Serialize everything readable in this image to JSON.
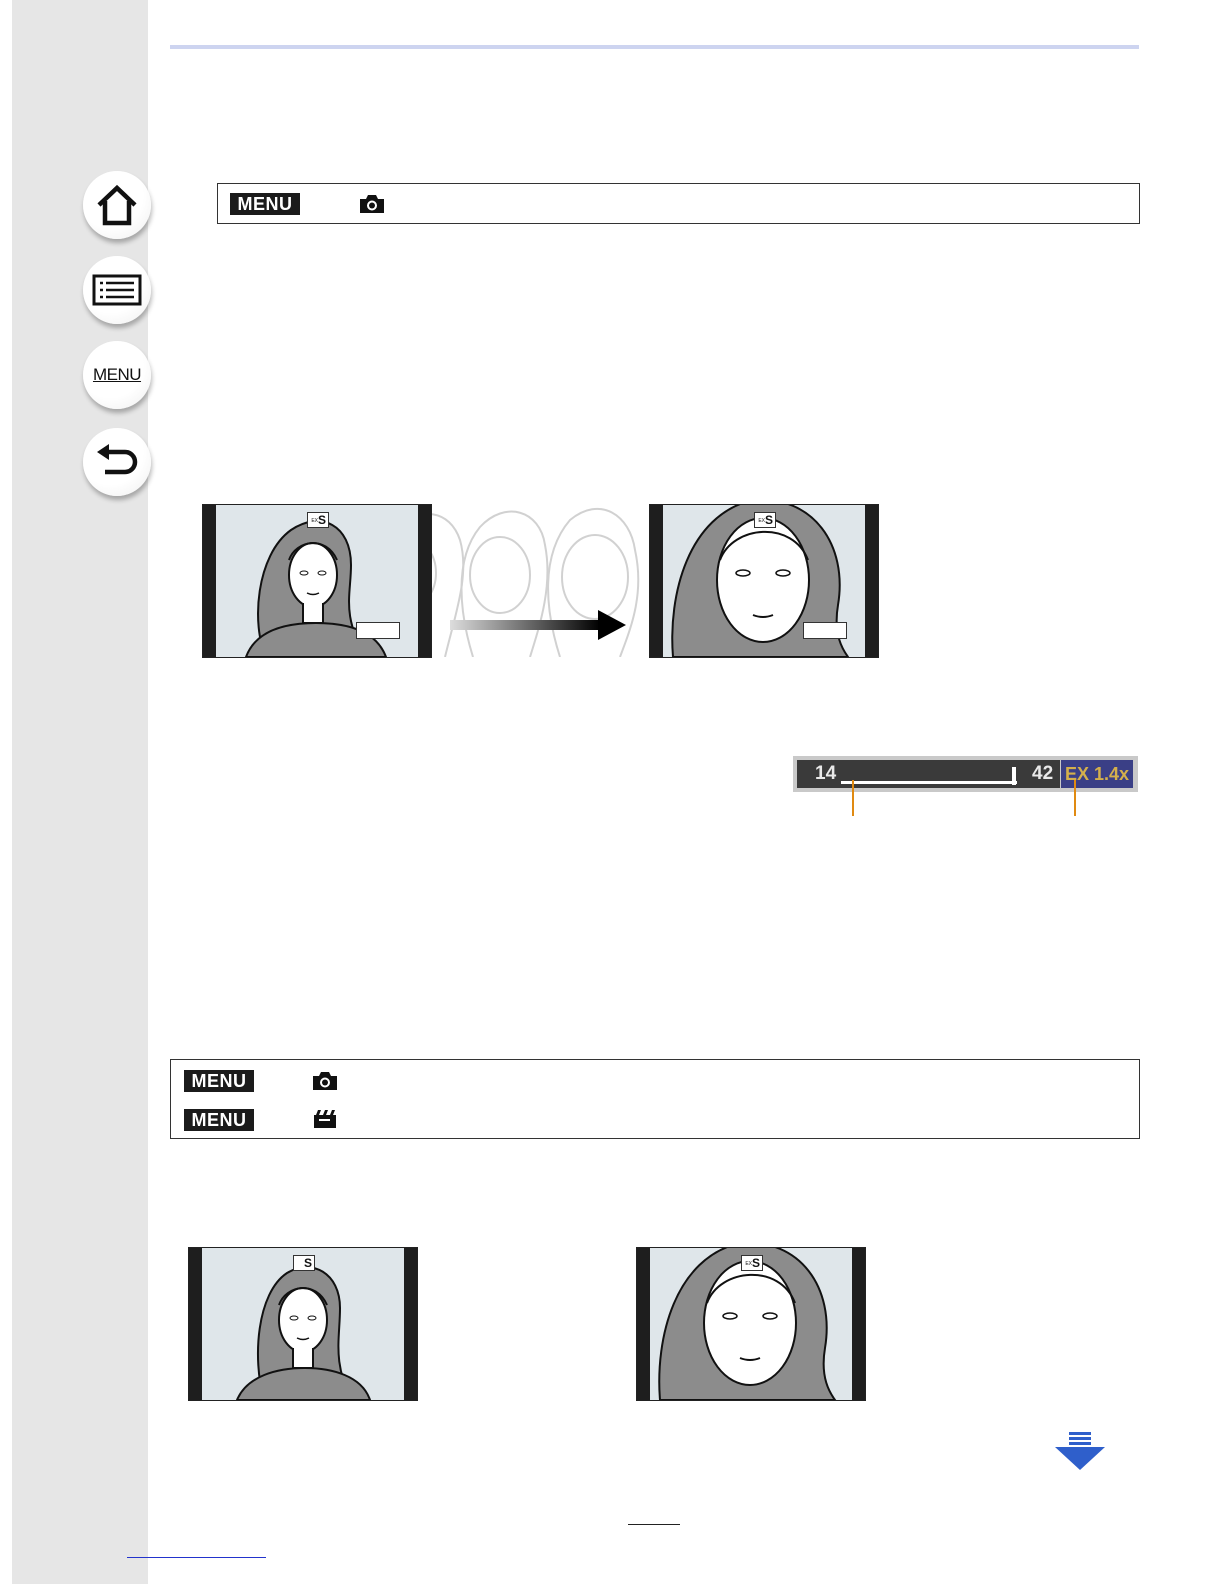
{
  "sidebar": {
    "home_icon": "home-icon",
    "contents_icon": "list-icon",
    "menu_label": "MENU",
    "back_icon": "return-arrow-icon"
  },
  "menu_path_1": {
    "badge": "MENU",
    "icon": "camera-icon"
  },
  "menu_path_2": [
    {
      "badge": "MENU",
      "icon": "camera-icon"
    },
    {
      "badge": "MENU",
      "icon": "movie-camera-icon"
    }
  ],
  "zoom_indicator": {
    "min": "14",
    "max": "42",
    "ex_label": "EX 1.4x",
    "level": 0.97
  },
  "next_page_icon": "scroll-down-arrow-icon",
  "colors": {
    "accent_rule": "#cdd4f0",
    "ex_background": "#3a3f86",
    "ex_text": "#d4b04c",
    "marker": "#e08a12"
  }
}
